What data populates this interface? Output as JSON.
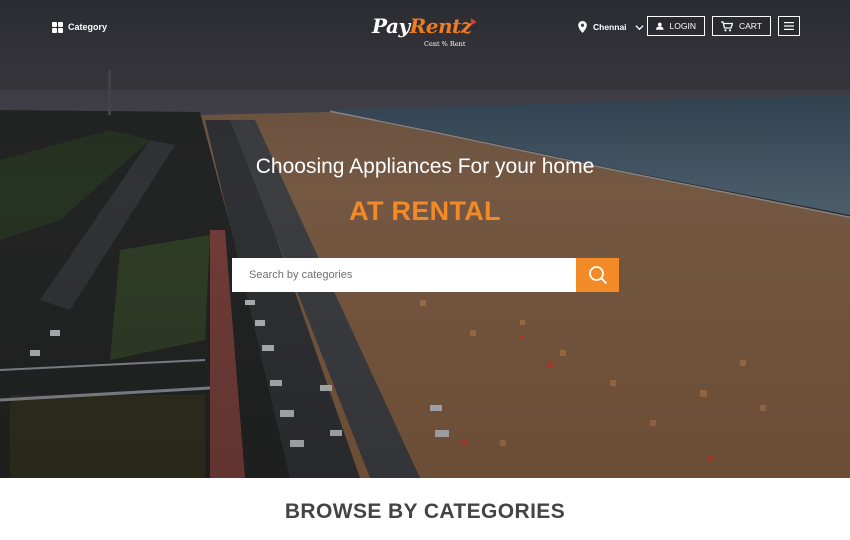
{
  "nav": {
    "category_label": "Category",
    "location_label": "Chennai",
    "login_label": "LOGIN",
    "cart_label": "CART"
  },
  "logo": {
    "brand_pay": "Pay",
    "brand_rentz": "Rentz",
    "tagline": "Cent % Rent"
  },
  "hero": {
    "headline": "Choosing Appliances For your home",
    "subheadline": "AT RENTAL"
  },
  "search": {
    "placeholder": "Search by categories",
    "value": ""
  },
  "browse": {
    "title": "BROWSE BY CATEGORIES"
  },
  "colors": {
    "accent": "#f28a27",
    "logo_accent": "#ef7c22",
    "text_dark": "#444444"
  },
  "icons": [
    "grid-icon",
    "location-pin-icon",
    "chevron-down-icon",
    "user-icon",
    "cart-icon",
    "hamburger-menu-icon",
    "search-icon"
  ]
}
